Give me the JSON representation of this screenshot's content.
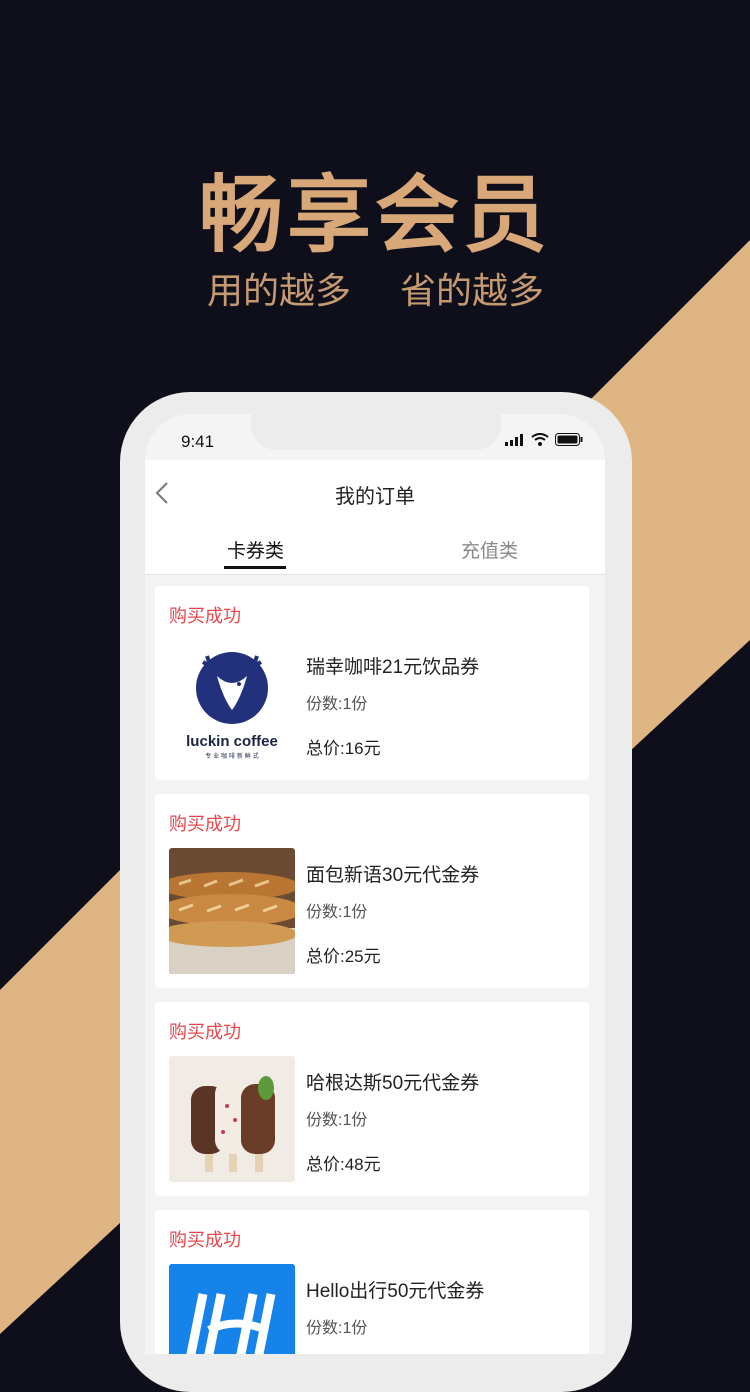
{
  "hero": {
    "title": "畅享会员",
    "subtitle_left": "用的越多",
    "subtitle_right": "省的越多"
  },
  "colors": {
    "background": "#0e0f1b",
    "stripe": "#dfb584",
    "accent_gold": "#d8a878",
    "status_red": "#e8484d"
  },
  "status_bar": {
    "time": "9:41"
  },
  "nav": {
    "title": "我的订单",
    "back_icon": "chevron-left-icon"
  },
  "tabs": [
    {
      "label": "卡券类",
      "active": true
    },
    {
      "label": "充值类",
      "active": false
    }
  ],
  "orders": [
    {
      "status": "购买成功",
      "name": "瑞幸咖啡21元饮品券",
      "quantity": "份数:1份",
      "total": "总价:16元",
      "logo_text": "luckin coffee",
      "logo_subtext": "专 业 咖 啡 新 鲜 式"
    },
    {
      "status": "购买成功",
      "name": "面包新语30元代金券",
      "quantity": "份数:1份",
      "total": "总价:25元"
    },
    {
      "status": "购买成功",
      "name": "哈根达斯50元代金券",
      "quantity": "份数:1份",
      "total": "总价:48元"
    },
    {
      "status": "购买成功",
      "name": "Hello出行50元代金券",
      "quantity": "份数:1份",
      "total": ""
    }
  ]
}
